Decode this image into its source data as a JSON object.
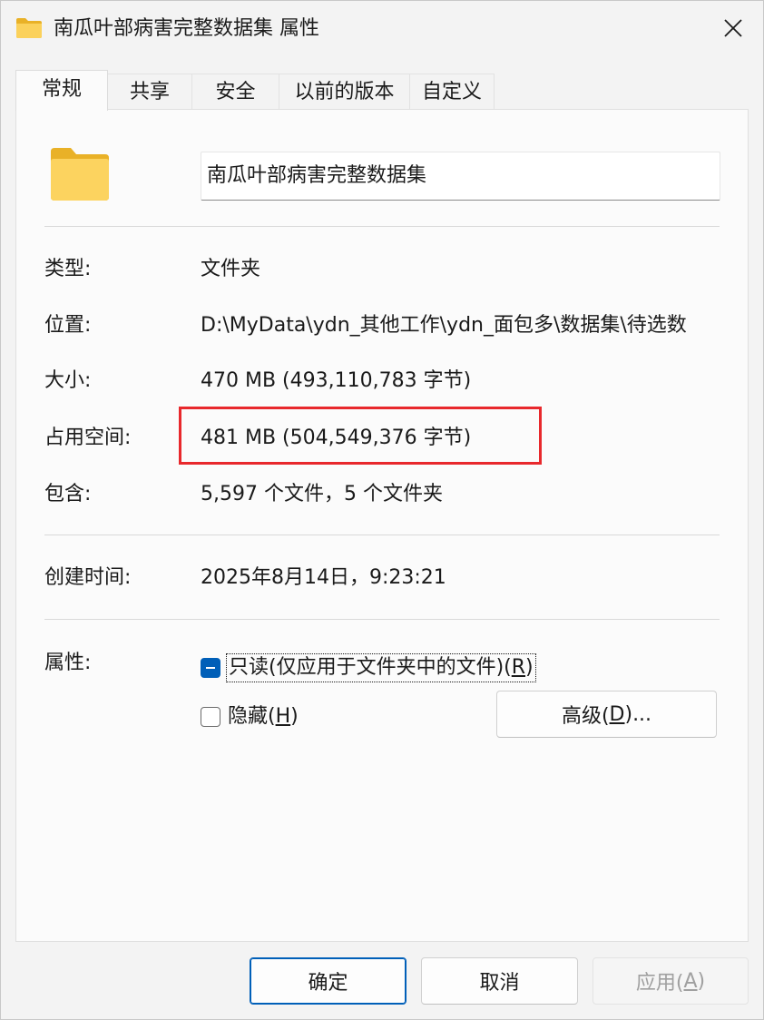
{
  "window": {
    "title": "南瓜叶部病害完整数据集 属性"
  },
  "tabs": [
    {
      "label": "常规",
      "active": true
    },
    {
      "label": "共享"
    },
    {
      "label": "安全"
    },
    {
      "label": "以前的版本"
    },
    {
      "label": "自定义"
    }
  ],
  "general": {
    "folder_name": "南瓜叶部病害完整数据集",
    "type_label": "类型:",
    "type_value": "文件夹",
    "location_label": "位置:",
    "location_value": "D:\\MyData\\ydn_其他工作\\ydn_面包多\\数据集\\待选数",
    "size_label": "大小:",
    "size_value": "470 MB (493,110,783 字节)",
    "disk_size_label": "占用空间:",
    "disk_size_value": "481 MB (504,549,376 字节)",
    "contains_label": "包含:",
    "contains_value": "5,597 个文件，5 个文件夹",
    "created_label": "创建时间:",
    "created_value": "2025年8月14日，9:23:21",
    "attributes_label": "属性:",
    "readonly_label_prefix": "只读(仅应用于文件夹中的文件)(",
    "readonly_key": "R",
    "readonly_suffix": ")",
    "hidden_prefix": "隐藏(",
    "hidden_key": "H",
    "hidden_suffix": ")",
    "advanced_prefix": "高级(",
    "advanced_key": "D",
    "advanced_suffix": ")..."
  },
  "footer": {
    "ok_label": "确定",
    "cancel_label": "取消",
    "apply_prefix": "应用(",
    "apply_key": "A",
    "apply_suffix": ")"
  },
  "colors": {
    "accent": "#005fb8",
    "highlight_box": "#e8282c",
    "folder_yellow": "#f8c944"
  },
  "icons": [
    "folder-icon",
    "close-icon"
  ]
}
